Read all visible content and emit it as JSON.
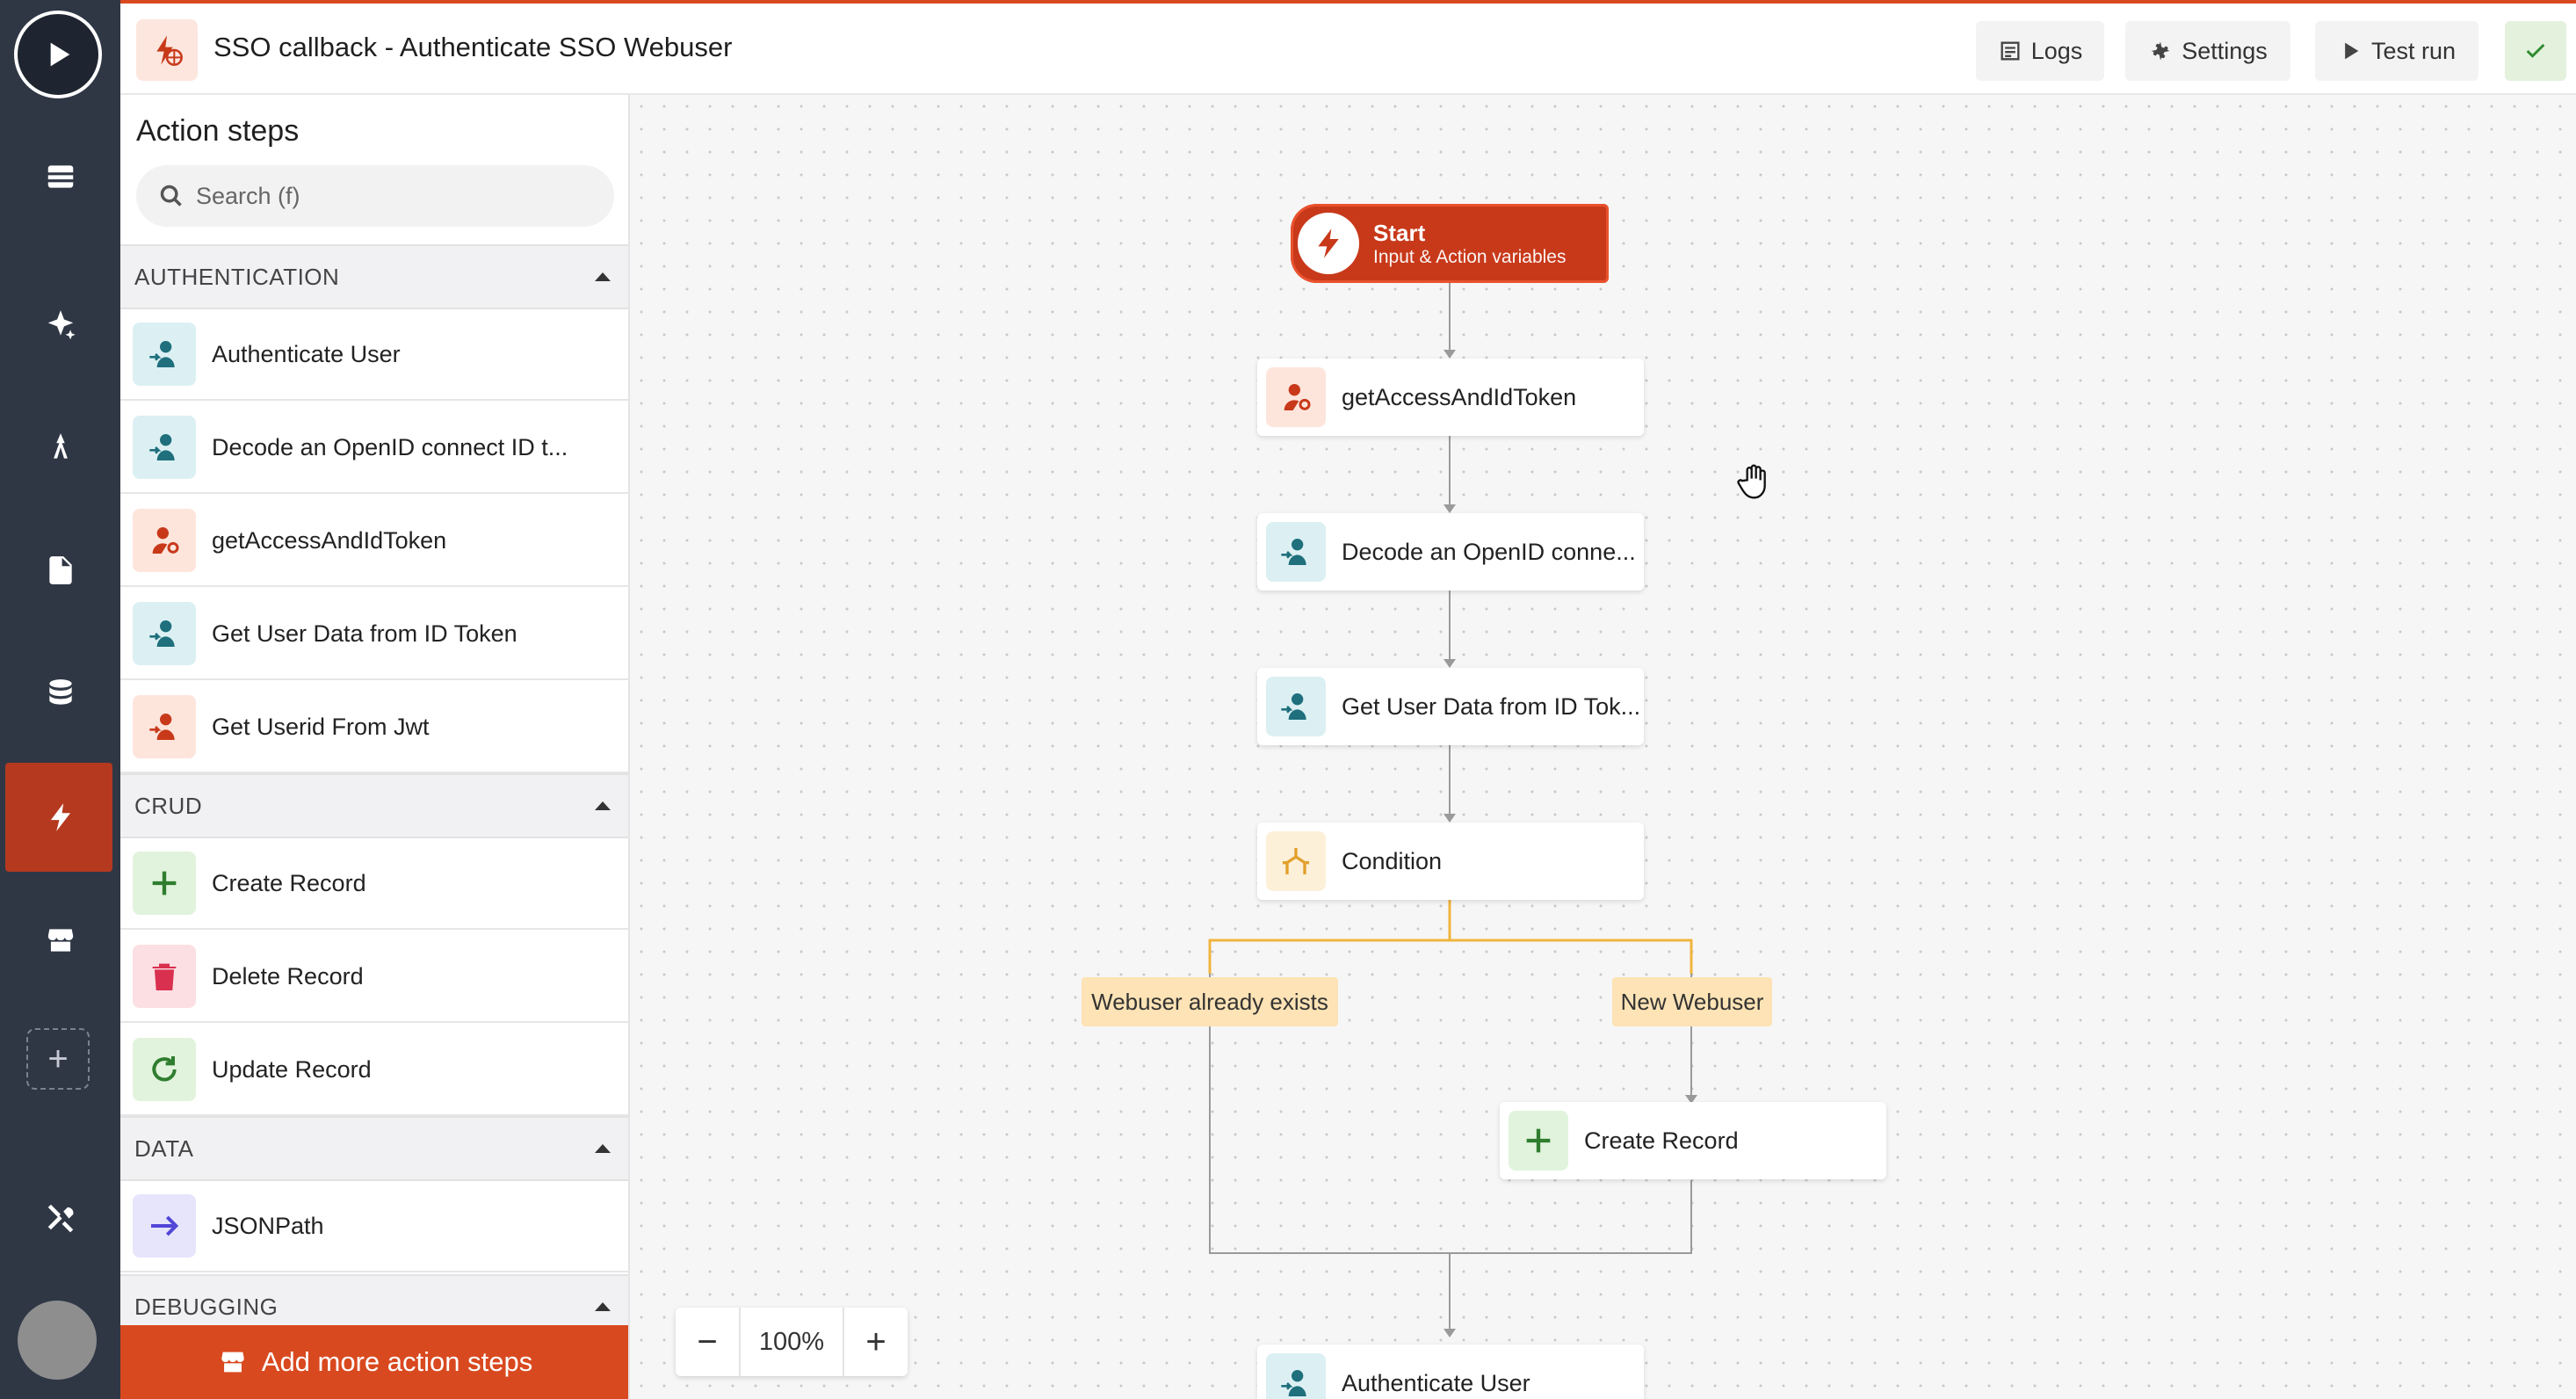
{
  "header": {
    "title": "SSO callback - Authenticate SSO Webuser",
    "logs_label": "Logs",
    "settings_label": "Settings",
    "test_run_label": "Test run"
  },
  "panel": {
    "title": "Action steps",
    "search_placeholder": "Search (f)",
    "sections": {
      "authentication": {
        "label": "AUTHENTICATION",
        "items": [
          "Authenticate User",
          "Decode an OpenID connect ID t...",
          "getAccessAndIdToken",
          "Get User Data from ID Token",
          "Get Userid From Jwt"
        ]
      },
      "crud": {
        "label": "CRUD",
        "items": [
          "Create Record",
          "Delete Record",
          "Update Record"
        ]
      },
      "data": {
        "label": "DATA",
        "items": [
          "JSONPath"
        ]
      },
      "debugging": {
        "label": "DEBUGGING"
      }
    },
    "add_more_label": "Add more action steps"
  },
  "canvas": {
    "start": {
      "title": "Start",
      "subtitle": "Input & Action variables"
    },
    "nodes": {
      "get_access": "getAccessAndIdToken",
      "decode": "Decode an OpenID conne...",
      "get_user_data": "Get User Data from ID Tok...",
      "condition": "Condition",
      "create_record": "Create Record",
      "authenticate": "Authenticate User"
    },
    "branches": {
      "left": "Webuser already exists",
      "right": "New Webuser"
    },
    "zoom": "100%"
  },
  "colors": {
    "accent": "#d9491f",
    "rail": "#2f3745",
    "branch_line": "#f0b43e"
  },
  "icons": {
    "rail": [
      "play-icon",
      "database-stack-icon",
      "sparkle-icon",
      "pen-tool-icon",
      "file-icon",
      "database-icon",
      "bolt-icon",
      "store-icon",
      "plus-icon",
      "tools-icon"
    ]
  }
}
